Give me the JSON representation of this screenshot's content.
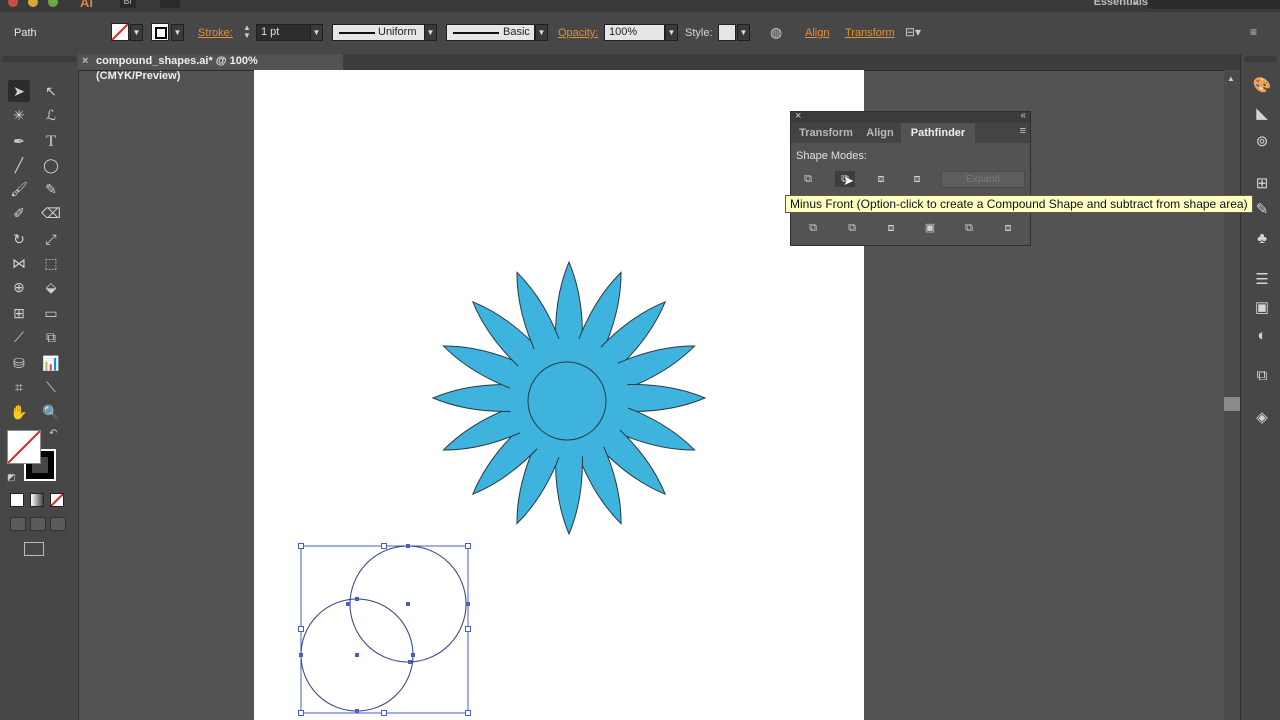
{
  "app": {
    "workspace_label": "Essentials",
    "app_badge": "Ai",
    "bridge_badge": "Br"
  },
  "controlbar": {
    "selection_type": "Path",
    "stroke_label": "Stroke:",
    "stroke_value": "1 pt",
    "profile_label": "Uniform",
    "brush_label": "Basic",
    "opacity_label": "Opacity:",
    "opacity_value": "100%",
    "style_label": "Style:",
    "align_link": "Align",
    "transform_link": "Transform"
  },
  "document": {
    "tab_title": "compound_shapes.ai* @ 100% (CMYK/Preview)",
    "close_glyph": "×"
  },
  "panel": {
    "close_glyph": "×",
    "collapse_glyph": "«",
    "tabs": [
      "Transform",
      "Align",
      "Pathfinder"
    ],
    "active_tab": "Pathfinder",
    "section_label": "Shape Modes:",
    "expand_label": "Expand",
    "menu_glyph": "≡"
  },
  "tooltip": {
    "text": "Minus Front (Option-click to create a Compound Shape and subtract from shape area)"
  },
  "colors": {
    "flower_fill": "#3db3de",
    "selection": "#4a5bd0",
    "accent_link": "#e0903a"
  },
  "icons": {
    "selection_tool": "selection-arrow-icon",
    "direct_selection_tool": "direct-selection-icon",
    "magic_wand_tool": "magic-wand-icon",
    "lasso_tool": "lasso-icon",
    "pen_tool": "pen-icon",
    "type_tool": "type-icon",
    "line_tool": "line-icon",
    "ellipse_tool": "ellipse-icon",
    "paintbrush_tool": "paintbrush-icon",
    "pencil_tool": "pencil-icon",
    "blob_brush_tool": "blob-brush-icon",
    "eraser_tool": "eraser-icon",
    "rotate_tool": "rotate-icon",
    "scale_tool": "scale-icon",
    "hand_tool": "hand-icon",
    "zoom_tool": "zoom-icon",
    "color_dock": "color-palette-icon",
    "layers_dock": "layers-icon"
  }
}
